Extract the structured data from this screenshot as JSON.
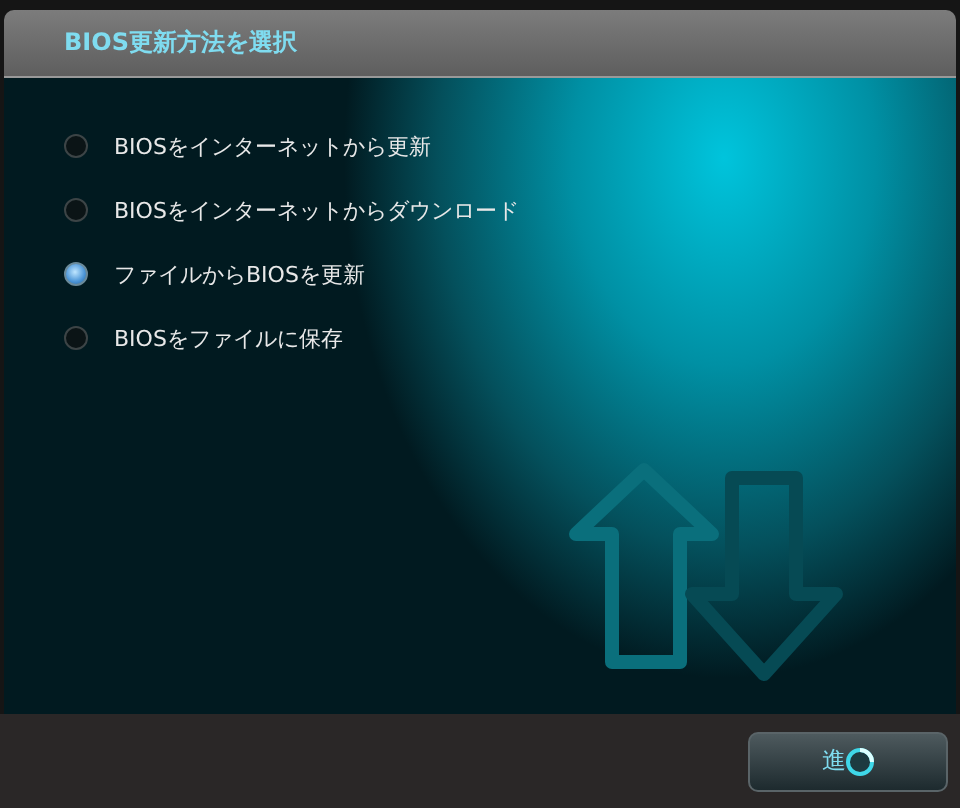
{
  "window": {
    "title": "BIOS更新方法を選択"
  },
  "options": [
    {
      "label": "BIOSをインターネットから更新",
      "selected": false
    },
    {
      "label": "BIOSをインターネットからダウンロード",
      "selected": false
    },
    {
      "label": "ファイルからBIOSを更新",
      "selected": true
    },
    {
      "label": "BIOSをファイルに保存",
      "selected": false
    }
  ],
  "buttons": [
    {
      "label": "進",
      "busy": true
    }
  ]
}
